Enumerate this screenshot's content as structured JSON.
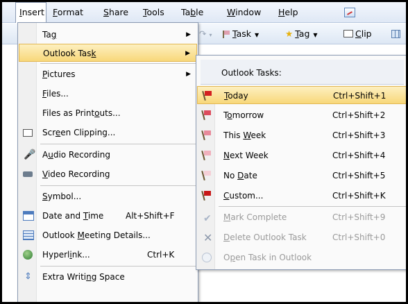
{
  "menubar": {
    "items": [
      "Insert",
      "Format",
      "Share",
      "Tools",
      "Table",
      "Window",
      "Help"
    ],
    "insert_pre": "",
    "insert_key": "I",
    "insert_post": "nsert",
    "format_pre": "",
    "format_key": "F",
    "format_post": "ormat",
    "share_pre": "",
    "share_key": "S",
    "share_post": "hare",
    "tools_pre": "",
    "tools_key": "T",
    "tools_post": "ools",
    "table_pre": "Ta",
    "table_key": "b",
    "table_post": "le",
    "window_pre": "",
    "window_key": "W",
    "window_post": "indow",
    "help_pre": "",
    "help_key": "H",
    "help_post": "elp"
  },
  "toolbar": {
    "task_key": "T",
    "task_post": "ask",
    "tag_key": "T",
    "tag_post": "ag",
    "clip_key": "C",
    "clip_post": "lip"
  },
  "insert_menu": {
    "tag": {
      "pre": "Ta",
      "key": "g",
      "post": ""
    },
    "outlook_task": {
      "pre": "Outlook Tas",
      "key": "k",
      "post": ""
    },
    "pictures": {
      "pre": "",
      "key": "P",
      "post": "ictures"
    },
    "files": {
      "pre": "",
      "key": "F",
      "post": "iles..."
    },
    "files_printouts": {
      "pre": "Files as Print",
      "key": "o",
      "post": "uts..."
    },
    "screen_clipping": {
      "pre": "Scr",
      "key": "e",
      "post": "en Clipping..."
    },
    "audio_recording": {
      "pre": "A",
      "key": "u",
      "post": "dio Recording"
    },
    "video_recording": {
      "pre": "",
      "key": "V",
      "post": "ideo Recording"
    },
    "symbol": {
      "pre": "",
      "key": "S",
      "post": "ymbol..."
    },
    "date_time": {
      "pre": "Date and ",
      "key": "T",
      "post": "ime",
      "shortcut": "Alt+Shift+F"
    },
    "meeting_details": {
      "pre": "Outlook ",
      "key": "M",
      "post": "eeting Details..."
    },
    "hyperlink": {
      "pre": "Hyperl",
      "key": "i",
      "post": "nk...",
      "shortcut": "Ctrl+K"
    },
    "writing_space": {
      "pre": "Extra Writi",
      "key": "n",
      "post": "g Space"
    }
  },
  "task_submenu": {
    "header": "Outlook Tasks:",
    "today": {
      "pre": "",
      "key": "T",
      "post": "oday",
      "shortcut": "Ctrl+Shift+1"
    },
    "tomorrow": {
      "pre": "T",
      "key": "o",
      "post": "morrow",
      "shortcut": "Ctrl+Shift+2"
    },
    "this_week": {
      "pre": "This ",
      "key": "W",
      "post": "eek",
      "shortcut": "Ctrl+Shift+3"
    },
    "next_week": {
      "pre": "",
      "key": "N",
      "post": "ext Week",
      "shortcut": "Ctrl+Shift+4"
    },
    "no_date": {
      "pre": "No ",
      "key": "D",
      "post": "ate",
      "shortcut": "Ctrl+Shift+5"
    },
    "custom": {
      "pre": "",
      "key": "C",
      "post": "ustom...",
      "shortcut": "Ctrl+Shift+K"
    },
    "mark_complete": {
      "pre": "",
      "key": "M",
      "post": "ark Complete",
      "shortcut": "Ctrl+Shift+9"
    },
    "delete_task": {
      "pre": "",
      "key": "D",
      "post": "elete Outlook Task",
      "shortcut": "Ctrl+Shift+0"
    },
    "open_task": {
      "pre": "O",
      "key": "p",
      "post": "en Task in Outlook"
    }
  },
  "colors": {
    "highlight": "#f8d87a",
    "flag_today": "#d42020",
    "flag_tomorrow": "#dd4c5c",
    "flag_week": "#e88a9a",
    "flag_next": "#f0b0bc",
    "flag_nodate": "#f5cfd6",
    "flag_custom": "#c81818"
  }
}
